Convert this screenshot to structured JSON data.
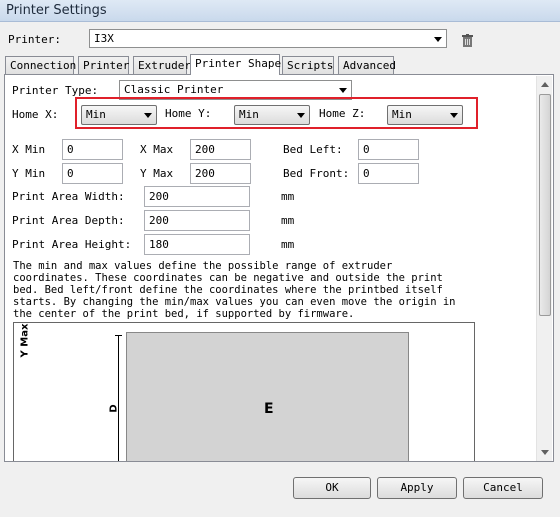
{
  "window": {
    "title": "Printer Settings"
  },
  "printer": {
    "label": "Printer:",
    "value": "I3X"
  },
  "tabs": [
    "Connection",
    "Printer",
    "Extruder",
    "Printer Shape",
    "Scripts",
    "Advanced"
  ],
  "shape": {
    "printer_type_label": "Printer Type:",
    "printer_type_value": "Classic Printer",
    "home_x_label": "Home X:",
    "home_x_value": "Min",
    "home_y_label": "Home Y:",
    "home_y_value": "Min",
    "home_z_label": "Home Z:",
    "home_z_value": "Min",
    "x_min_label": "X Min",
    "x_min": "0",
    "x_max_label": "X Max",
    "x_max": "200",
    "bed_left_label": "Bed Left:",
    "bed_left": "0",
    "y_min_label": "Y Min",
    "y_min": "0",
    "y_max_label": "Y Max",
    "y_max": "200",
    "bed_front_label": "Bed Front:",
    "bed_front": "0",
    "width_label": "Print Area Width:",
    "width": "200",
    "width_unit": "mm",
    "depth_label": "Print Area Depth:",
    "depth": "200",
    "depth_unit": "mm",
    "height_label": "Print Area Height:",
    "height": "180",
    "height_unit": "mm",
    "description": "The min and max values define the possible range of extruder coordinates. These coordinates can be negative and outside the print bed. Bed left/front define the coordinates where the printbed itself starts. By changing the min/max values you can even move the origin in the center of the print bed, if supported by firmware."
  },
  "diagram": {
    "y_label": "Y Max",
    "d_label": "D",
    "e_label": "E"
  },
  "buttons": {
    "ok": "OK",
    "apply": "Apply",
    "cancel": "Cancel"
  }
}
